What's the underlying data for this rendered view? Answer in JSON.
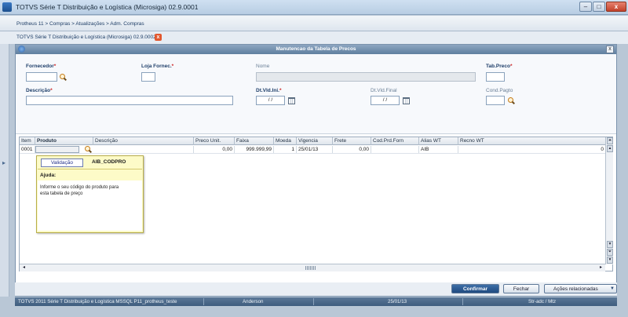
{
  "window": {
    "title": "TOTVS Série T Distribuição e Logística (Microsiga) 02.9.0001",
    "min": "–",
    "max": "□",
    "close": "x"
  },
  "breadcrumb": "Protheus 11 > Compras > Atualizações > Adm. Compras",
  "subheader": {
    "label": "TOTVS Série T Distribuição e Logística (Microsiga) 02.9.0002",
    "close_glyph": "x"
  },
  "dialog": {
    "title": "Manutencao da Tabela de Precos",
    "close": "x",
    "fields": {
      "fornecedor": {
        "label": "Fornecedor",
        "req": "*",
        "value": ""
      },
      "loja": {
        "label": "Loja Fornec.",
        "req": "*",
        "value": ""
      },
      "nome": {
        "label": "Nome",
        "value": ""
      },
      "tabpreco": {
        "label": "Tab.Preco",
        "req": "*",
        "value": ""
      },
      "descricao": {
        "label": "Descrição",
        "req": "*",
        "value": ""
      },
      "dtini": {
        "label": "Dt.Vld.Ini.",
        "req": "*",
        "value": " / /"
      },
      "dtfinal": {
        "label": "Dt.Vld.Final",
        "value": " / /"
      },
      "condpagto": {
        "label": "Cond.Pagto",
        "value": ""
      }
    }
  },
  "grid": {
    "columns": [
      "Item",
      "Produto",
      "Descrição",
      "Preco Unit.",
      "Faixa",
      "Moeda",
      "Vigencia",
      "Frete",
      "Cod.Prd.Forn",
      "Alias WT",
      "Recno WT"
    ],
    "row": {
      "item": "0001",
      "produto": "",
      "descricao": "",
      "preco": "0,00",
      "faixa": "999.999,99",
      "moeda": "1",
      "vigencia": "25/01/13",
      "frete": "0,00",
      "codprd": "",
      "alias": "AIB",
      "recno": "0"
    }
  },
  "tooltip": {
    "tab": "Validação",
    "field": "AIB_CODPRO",
    "heading": "Ajuda:",
    "text": "Informe o seu código do produto para esta tabela de preço"
  },
  "buttons": {
    "confirm": "Confirmar",
    "close": "Fechar",
    "actions": "Ações relacionadas",
    "actions_caret": "▼"
  },
  "statusbar": {
    "system": "TOTVS 2011 Série T Distribuição e Logística MSSQL P11_protheus_teste",
    "user": "Anderson",
    "date": "25/01/13",
    "env": "Str-adc / Mtz"
  }
}
